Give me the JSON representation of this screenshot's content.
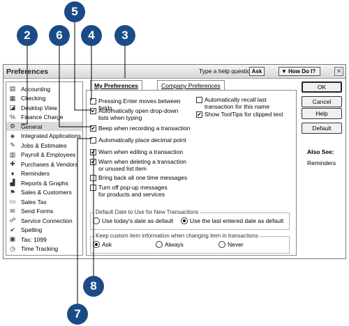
{
  "window": {
    "title": "Preferences",
    "help_question": "Type a help question",
    "ask_label": "Ask",
    "how_do_i_label": "How Do I?"
  },
  "sidebar": {
    "items": [
      {
        "label": "Accounting",
        "icon": "accounting-icon",
        "selected": false
      },
      {
        "label": "Checking",
        "icon": "checking-icon",
        "selected": false
      },
      {
        "label": "Desktop View",
        "icon": "desktop-view-icon",
        "selected": false
      },
      {
        "label": "Finance Charge",
        "icon": "finance-charge-icon",
        "selected": false
      },
      {
        "label": "General",
        "icon": "general-icon",
        "selected": true
      },
      {
        "label": "Integrated Applications",
        "icon": "integrated-applications-icon",
        "selected": false
      },
      {
        "label": "Jobs & Estimates",
        "icon": "jobs-estimates-icon",
        "selected": false
      },
      {
        "label": "Payroll & Employees",
        "icon": "payroll-icon",
        "selected": false
      },
      {
        "label": "Purchases & Vendors",
        "icon": "purchases-icon",
        "selected": false
      },
      {
        "label": "Reminders",
        "icon": "reminders-icon",
        "selected": false
      },
      {
        "label": "Reports & Graphs",
        "icon": "reports-icon",
        "selected": false
      },
      {
        "label": "Sales & Customers",
        "icon": "sales-icon",
        "selected": false
      },
      {
        "label": "Sales Tax",
        "icon": "sales-tax-icon",
        "selected": false
      },
      {
        "label": "Send Forms",
        "icon": "send-forms-icon",
        "selected": false
      },
      {
        "label": "Service Connection",
        "icon": "service-connection-icon",
        "selected": false
      },
      {
        "label": "Spelling",
        "icon": "spelling-icon",
        "selected": false
      },
      {
        "label": "Tax: 1099",
        "icon": "tax-1099-icon",
        "selected": false
      },
      {
        "label": "Time Tracking",
        "icon": "time-tracking-icon",
        "selected": false
      }
    ]
  },
  "tabs": [
    {
      "label": "My Preferences",
      "active": true
    },
    {
      "label": "Company Preferences",
      "active": false
    }
  ],
  "options_left": [
    {
      "label": "Pressing Enter moves between fields",
      "checked": false
    },
    {
      "label": "Automatically open drop-down lists when typing",
      "checked": true
    },
    {
      "label": "Beep when recording a transaction",
      "checked": true
    },
    {
      "label": "Automatically place decimal point",
      "checked": false
    },
    {
      "label": "Warn when editing a transaction",
      "checked": true
    },
    {
      "label": "Warn when deleting a transaction or unused list item",
      "checked": true
    },
    {
      "label": "Bring back all one time messages",
      "checked": false
    },
    {
      "label": "Turn off pop-up messages for products and services",
      "checked": false
    }
  ],
  "options_right": [
    {
      "label": "Automatically recall last transaction for this name",
      "checked": false
    },
    {
      "label": "Show ToolTips for clipped text",
      "checked": true
    }
  ],
  "default_date": {
    "label": "Default Date to Use for New Transactions",
    "options": [
      {
        "label": "Use today's date as default",
        "selected": false
      },
      {
        "label": "Use the last entered date as default",
        "selected": true
      }
    ]
  },
  "custom_item": {
    "label": "Keep custom item information when changing item in transactions",
    "options": [
      {
        "label": "Ask",
        "selected": true
      },
      {
        "label": "Always",
        "selected": false
      },
      {
        "label": "Never",
        "selected": false
      }
    ]
  },
  "buttons": {
    "ok": "OK",
    "cancel": "Cancel",
    "help": "Help",
    "default": "Default"
  },
  "also_see": {
    "label": "Also See:",
    "link": "Reminders"
  },
  "callouts": [
    "5",
    "2",
    "6",
    "4",
    "3",
    "8",
    "7"
  ],
  "colors": {
    "callout": "#1b4b86",
    "selected_row": "#d9d9d9"
  }
}
